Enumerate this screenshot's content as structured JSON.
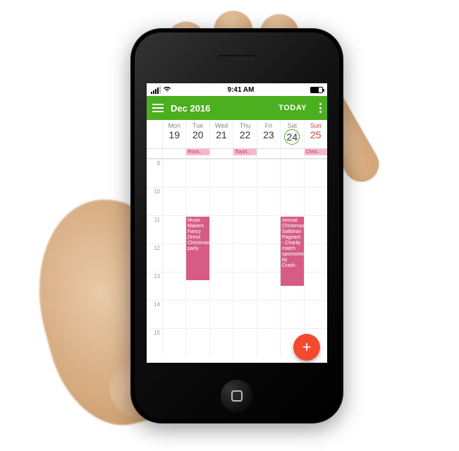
{
  "statusbar": {
    "time": "9:41 AM"
  },
  "header": {
    "title": "Dec 2016",
    "today_label": "TODAY"
  },
  "week": {
    "days": [
      {
        "dow": "Mon",
        "num": "19"
      },
      {
        "dow": "Tue",
        "num": "20"
      },
      {
        "dow": "Wed",
        "num": "21"
      },
      {
        "dow": "Thu",
        "num": "22"
      },
      {
        "dow": "Fri",
        "num": "23"
      },
      {
        "dow": "Sat",
        "num": "24"
      },
      {
        "dow": "Sun",
        "num": "25"
      }
    ]
  },
  "allday": {
    "tue": "Ross..",
    "thu": "Toyot..",
    "sun": "Chris.."
  },
  "hours": [
    "9",
    "10",
    "11",
    "12",
    "13",
    "14",
    "15"
  ],
  "events": {
    "e1": "Music Makers Fancy Dress Christmas party",
    "e2": "Annual Christmas Saltdean Pageant - Charity match sponsored by Crash.."
  },
  "colors": {
    "header_bg": "#4caf1f",
    "event_bg": "#d65c85",
    "allday_chip_bg": "#f7b7c8",
    "fab_bg": "#f24a2e",
    "sunday_text": "#d04040"
  },
  "fab": {
    "glyph": "+"
  }
}
